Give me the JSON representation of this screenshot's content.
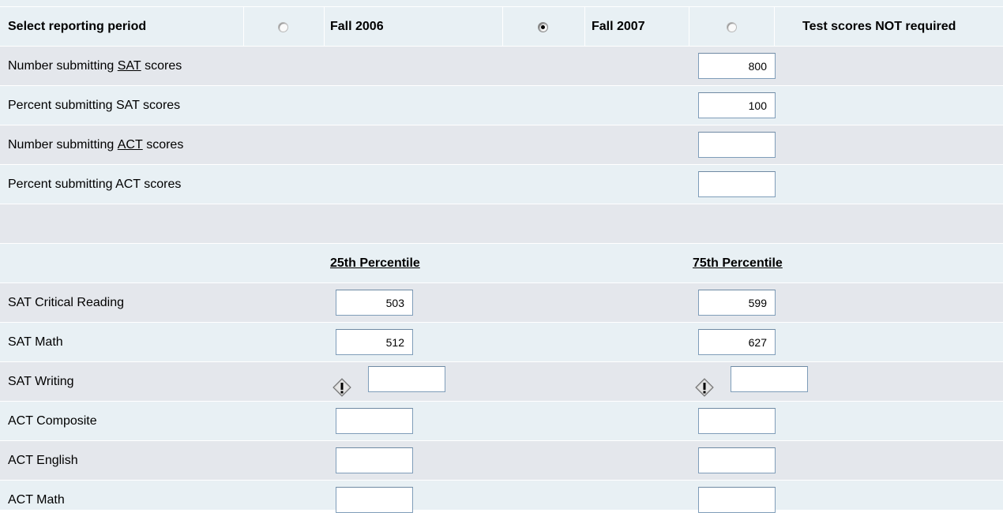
{
  "header": {
    "label": "Select reporting period",
    "options": [
      {
        "label": "Fall 2006",
        "checked": false
      },
      {
        "label": "Fall 2007",
        "checked": true
      },
      {
        "label": "Test scores NOT required",
        "checked": false
      }
    ]
  },
  "submission": {
    "rows": [
      {
        "prefix": "Number submitting ",
        "link": "SAT",
        "suffix": " scores",
        "value": "800"
      },
      {
        "text": "Percent submitting SAT scores",
        "value": "100"
      },
      {
        "prefix": "Number submitting ",
        "link": "ACT",
        "suffix": " scores",
        "value": ""
      },
      {
        "text": "Percent submitting ACT scores",
        "value": ""
      }
    ]
  },
  "percentiles": {
    "col_25": "25th Percentile",
    "col_75": "75th Percentile",
    "rows": [
      {
        "label": "SAT Critical Reading",
        "p25": "503",
        "p75": "599"
      },
      {
        "label": "SAT Math",
        "p25": "512",
        "p75": "627"
      },
      {
        "label": "SAT Writing",
        "p25": "",
        "p75": "",
        "warning": true
      },
      {
        "label": "ACT Composite",
        "p25": "",
        "p75": ""
      },
      {
        "label": "ACT English",
        "p25": "",
        "p75": ""
      },
      {
        "label": "ACT Math",
        "p25": "",
        "p75": ""
      }
    ]
  }
}
